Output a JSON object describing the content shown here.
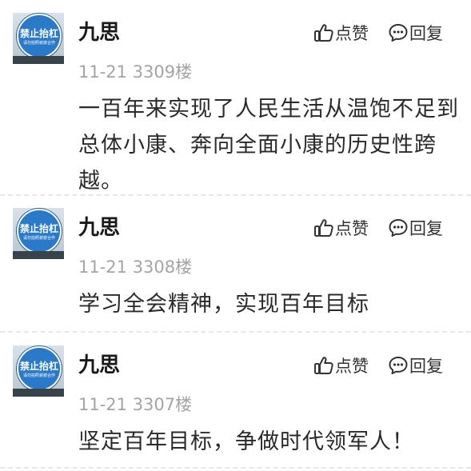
{
  "comments": [
    {
      "username": "九思",
      "meta": "11-21 3309楼",
      "lines": [
        "一百年来实现了人民生活从温饱不足到",
        "总体小康、奔向全面小康的历史性跨",
        "越。"
      ],
      "like_label": "点赞",
      "reply_label": "回复",
      "avatar": {
        "sign_main": "禁止抬杠",
        "sign_sub": "请勿拍照谢谢合作"
      }
    },
    {
      "username": "九思",
      "meta": "11-21 3308楼",
      "lines": [
        "学习全会精神，实现百年目标"
      ],
      "like_label": "点赞",
      "reply_label": "回复",
      "avatar": {
        "sign_main": "禁止抬杠",
        "sign_sub": "请勿拍照谢谢合作"
      }
    },
    {
      "username": "九思",
      "meta": "11-21 3307楼",
      "lines": [
        "坚定百年目标，争做时代领军人！"
      ],
      "like_label": "点赞",
      "reply_label": "回复",
      "avatar": {
        "sign_main": "禁止抬杠",
        "sign_sub": "请勿拍照谢谢合作"
      }
    }
  ],
  "colors": {
    "text": "#2a2a2a",
    "meta": "#a4a4a4",
    "sign_blue": "#2b79c9",
    "divider": "#e7e7e7"
  },
  "icons": {
    "like": "thumbs-up-icon",
    "reply": "speech-bubble-icon"
  }
}
